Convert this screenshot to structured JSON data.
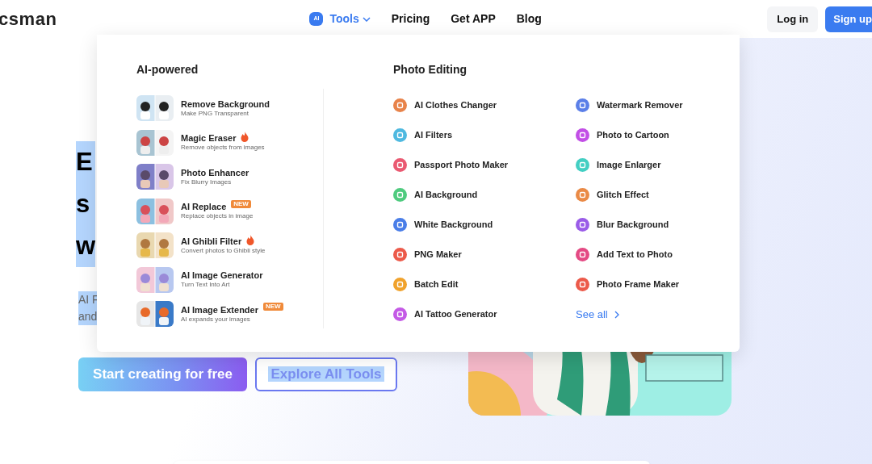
{
  "header": {
    "logo": "csman",
    "nav": [
      {
        "label": "Tools",
        "kind": "menu",
        "selected": true,
        "badge": "AI"
      },
      {
        "label": "Pricing",
        "kind": "link",
        "selected": false
      },
      {
        "label": "Get APP",
        "kind": "link",
        "selected": false
      },
      {
        "label": "Blog",
        "kind": "link",
        "selected": false
      }
    ],
    "login": "Log in",
    "signup": "Sign up"
  },
  "hero": {
    "text_selected": true,
    "heading_lines": [
      "E",
      "s",
      "w"
    ],
    "subtitle_lines": [
      "AI F",
      "and"
    ],
    "primary_button": "Start creating for free",
    "secondary_button": "Explore All Tools"
  },
  "dropdown": {
    "ai_title": "AI-powered",
    "ai_items": [
      {
        "title": "Remove Background",
        "subtitle": "Make PNG Transparent"
      },
      {
        "title": "Magic Eraser",
        "subtitle": "Remove objects from images",
        "tag": {
          "kind": "hot"
        }
      },
      {
        "title": "Photo Enhancer",
        "subtitle": "Fix Blurry Images"
      },
      {
        "title": "AI Replace",
        "subtitle": "Replace objects in image",
        "tag": {
          "kind": "new",
          "text": "NEW"
        }
      },
      {
        "title": "AI Ghibli Filter",
        "subtitle": "Convert photos to Ghibli style",
        "tag": {
          "kind": "hot"
        }
      },
      {
        "title": "AI Image Generator",
        "subtitle": "Turn Text Into Art"
      },
      {
        "title": "AI Image Extender",
        "subtitle": "AI expands your images",
        "tag": {
          "kind": "new",
          "text": "NEW"
        }
      }
    ],
    "photo_title": "Photo Editing",
    "photo_columns": [
      [
        {
          "label": "AI Clothes Changer",
          "color": "#e8834a"
        },
        {
          "label": "AI Filters",
          "color": "#4fb9e0"
        },
        {
          "label": "Passport Photo Maker",
          "color": "#ea5a72"
        },
        {
          "label": "AI Background",
          "color": "#4fcb7f"
        },
        {
          "label": "White Background",
          "color": "#4a7ee8"
        },
        {
          "label": "PNG Maker",
          "color": "#ec5a4a"
        },
        {
          "label": "Batch Edit",
          "color": "#f0a22c"
        },
        {
          "label": "AI Tattoo Generator",
          "color": "#c45ae6"
        }
      ],
      [
        {
          "label": "Watermark Remover",
          "color": "#5b7fe8"
        },
        {
          "label": "Photo to Cartoon",
          "color": "#c24fe6"
        },
        {
          "label": "Image Enlarger",
          "color": "#43cfc3"
        },
        {
          "label": "Glitch Effect",
          "color": "#ea8a46"
        },
        {
          "label": "Blur Background",
          "color": "#9a5ce8"
        },
        {
          "label": "Add Text to Photo",
          "color": "#e44a84"
        },
        {
          "label": "Photo Frame Maker",
          "color": "#ec5a4a"
        }
      ]
    ],
    "see_all": "See all"
  }
}
